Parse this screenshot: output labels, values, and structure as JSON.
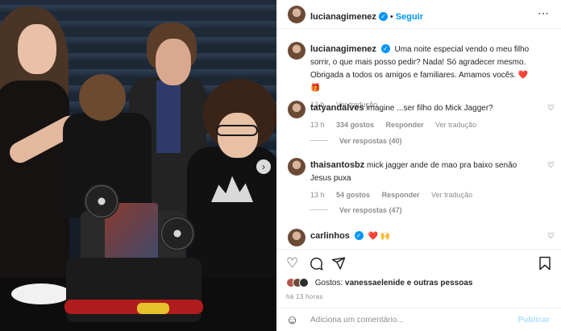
{
  "post": {
    "username": "lucianagimenez",
    "follow_label": "Seguir",
    "separator": "•",
    "caption": "Uma noite especial vendo o meu filho sorrir, o que mais posso pedir? Nada! Só agradecer mesmo. Obrigada a todos os amigos e familiares. Amamos vocês. ❤️ 🎁",
    "caption_age": "13 h",
    "translate_label": "Ver tradução"
  },
  "comments": [
    {
      "username": "tatyandalves",
      "text": "imagine ...ser filho do Mick Jagger?",
      "age": "13 h",
      "likes": "334 gostos",
      "reply": "Responder",
      "translate": "Ver tradução",
      "view_replies": "Ver respostas (40)"
    },
    {
      "username": "thaisantosbz",
      "text": "mick jagger ande de mao pra baixo senão Jesus puxa",
      "age": "13 h",
      "likes": "54 gostos",
      "reply": "Responder",
      "translate": "Ver tradução",
      "view_replies": "Ver respostas (47)"
    },
    {
      "username": "carlinhos",
      "text": "❤️ 🙌"
    }
  ],
  "likes_summary": {
    "prefix": "Gostos: ",
    "names": "vanessaelenide e outras pessoas"
  },
  "time_ago": "há 13 horas",
  "add_comment": {
    "placeholder": "Adiciona um comentário...",
    "publish_label": "Publicar"
  },
  "icons": {
    "heart": "heart-icon",
    "comment": "comment-icon",
    "share": "share-icon",
    "save": "bookmark-icon",
    "emoji": "emoji-icon",
    "more": "more-icon",
    "verified": "verified-badge-icon"
  },
  "colors": {
    "accent": "#0095f6",
    "text": "#262626",
    "muted": "#8e8e8e",
    "heart_red": "#ed4956"
  }
}
